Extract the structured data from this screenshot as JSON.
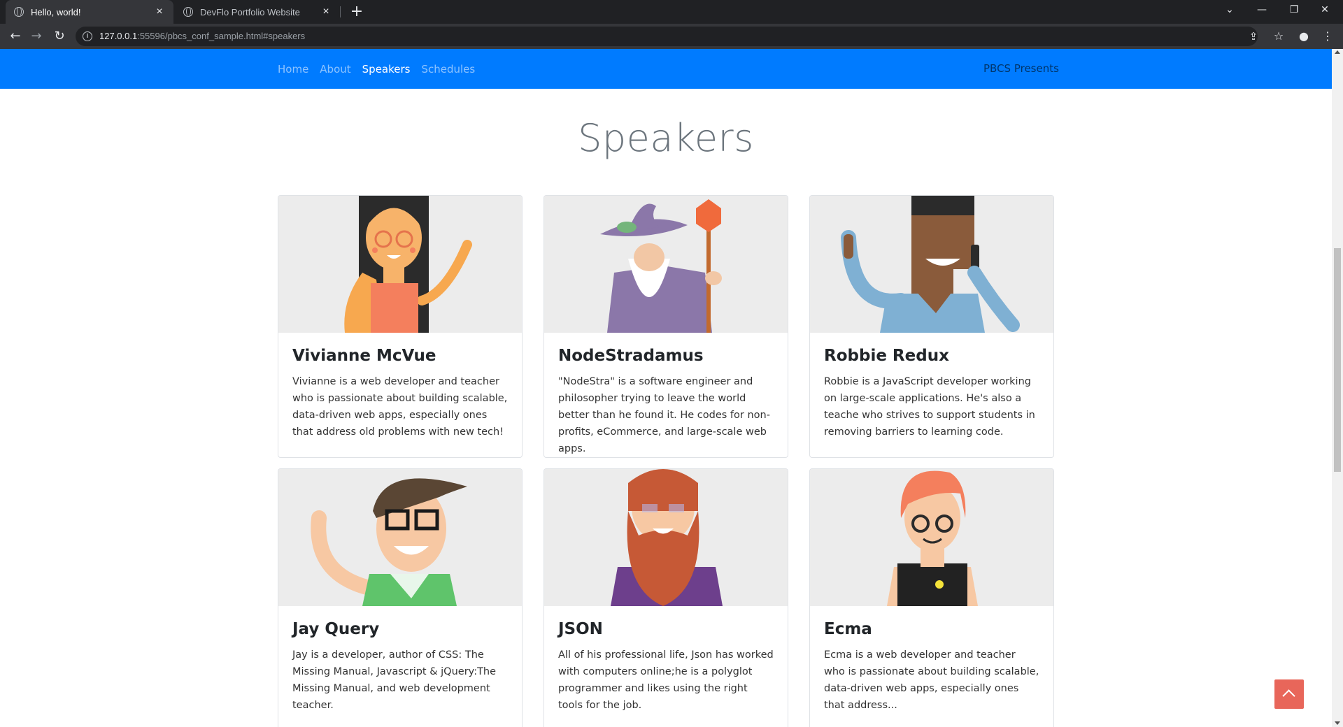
{
  "browser": {
    "tabs": [
      {
        "title": "Hello, world!",
        "active": true
      },
      {
        "title": "DevFlo Portfolio Website",
        "active": false
      }
    ],
    "url_host": "127.0.0.1",
    "url_rest": ":55596/pbcs_conf_sample.html#speakers"
  },
  "site_nav": {
    "links": [
      "Home",
      "About",
      "Speakers",
      "Schedules"
    ],
    "active_link": "Speakers",
    "brand": "PBCS Presents",
    "color": "#007bff"
  },
  "speakers_section": {
    "title": "Speakers",
    "speakers": [
      {
        "name": "Vivianne McVue",
        "bio": "Vivianne is a web developer and teacher who is passionate about building scalable, data-driven web apps, especially ones that address old problems with new tech!"
      },
      {
        "name": "NodeStradamus",
        "bio": "\"NodeStra\" is a software engineer and philosopher trying to leave the world better than he found it. He codes for non-profits, eCommerce, and large-scale web apps."
      },
      {
        "name": "Robbie Redux",
        "bio": "Robbie is a JavaScript developer working on large-scale applications. He's also a teache who strives to support students in removing barriers to learning code."
      },
      {
        "name": "Jay Query",
        "bio": "Jay is a developer, author of CSS: The Missing Manual, Javascript & jQuery:The Missing Manual, and web development teacher."
      },
      {
        "name": "JSON",
        "bio": "All of his professional life, Json has worked with computers online;he is a polyglot programmer and likes using the right tools for the job."
      },
      {
        "name": "Ecma",
        "bio": "Ecma is a web developer and teacher who is passionate about building scalable, data-driven web apps, especially ones that address..."
      }
    ]
  },
  "back_to_top": {
    "icon": "chevron-up-icon",
    "color": "#e8665a"
  }
}
